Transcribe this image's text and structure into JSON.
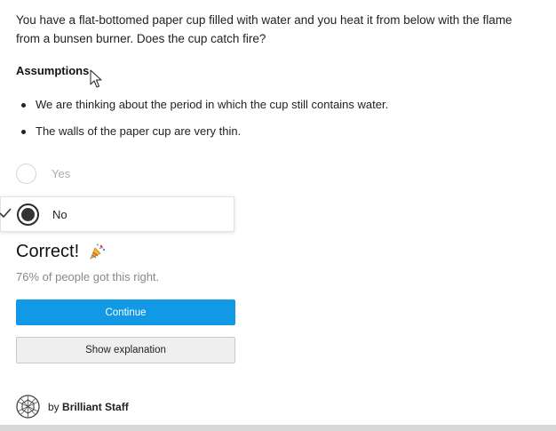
{
  "question": {
    "text": "You have a flat-bottomed paper cup filled with water and you heat it from below with the flame from a bunsen burner. Does the cup catch fire?"
  },
  "assumptions": {
    "title": "Assumptions",
    "items": [
      "We are thinking about the period in which the cup still contains water.",
      "The walls of the paper cup are very thin."
    ]
  },
  "options": {
    "yes": {
      "label": "Yes",
      "selected": false
    },
    "no": {
      "label": "No",
      "selected": true
    }
  },
  "result": {
    "title": "Correct!",
    "stats": "76% of people got this right.",
    "accent_color": "#1199e6"
  },
  "actions": {
    "continue_label": "Continue",
    "explanation_label": "Show explanation"
  },
  "author": {
    "prefix": "by",
    "name": "Brilliant Staff"
  },
  "icons": {
    "cursor": "mouse-pointer-icon",
    "check": "checkmark-icon",
    "party": "party-popper-icon",
    "avatar": "geodesic-sphere-icon"
  }
}
